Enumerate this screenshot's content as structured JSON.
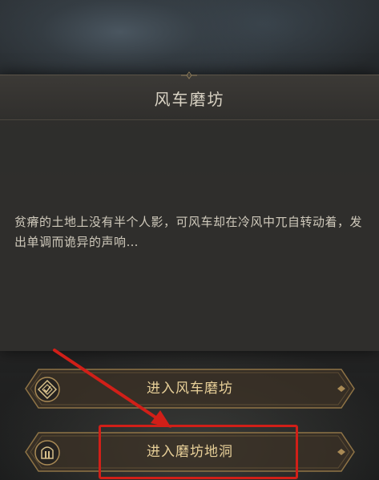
{
  "dialog": {
    "title": "风车磨坊",
    "description": "贫瘠的土地上没有半个人影，可风车却在冷风中兀自转动着，发出单调而诡异的声响…"
  },
  "options": [
    {
      "label": "进入风车磨坊",
      "icon": "compass-diamond-icon"
    },
    {
      "label": "进入磨坊地洞",
      "icon": "cave-door-icon"
    }
  ],
  "annotation": {
    "arrow_color": "#d11f18",
    "highlight_color": "#d11f18"
  },
  "colors": {
    "button_text": "#e7cf98",
    "gold_trim": "#a98a55"
  }
}
